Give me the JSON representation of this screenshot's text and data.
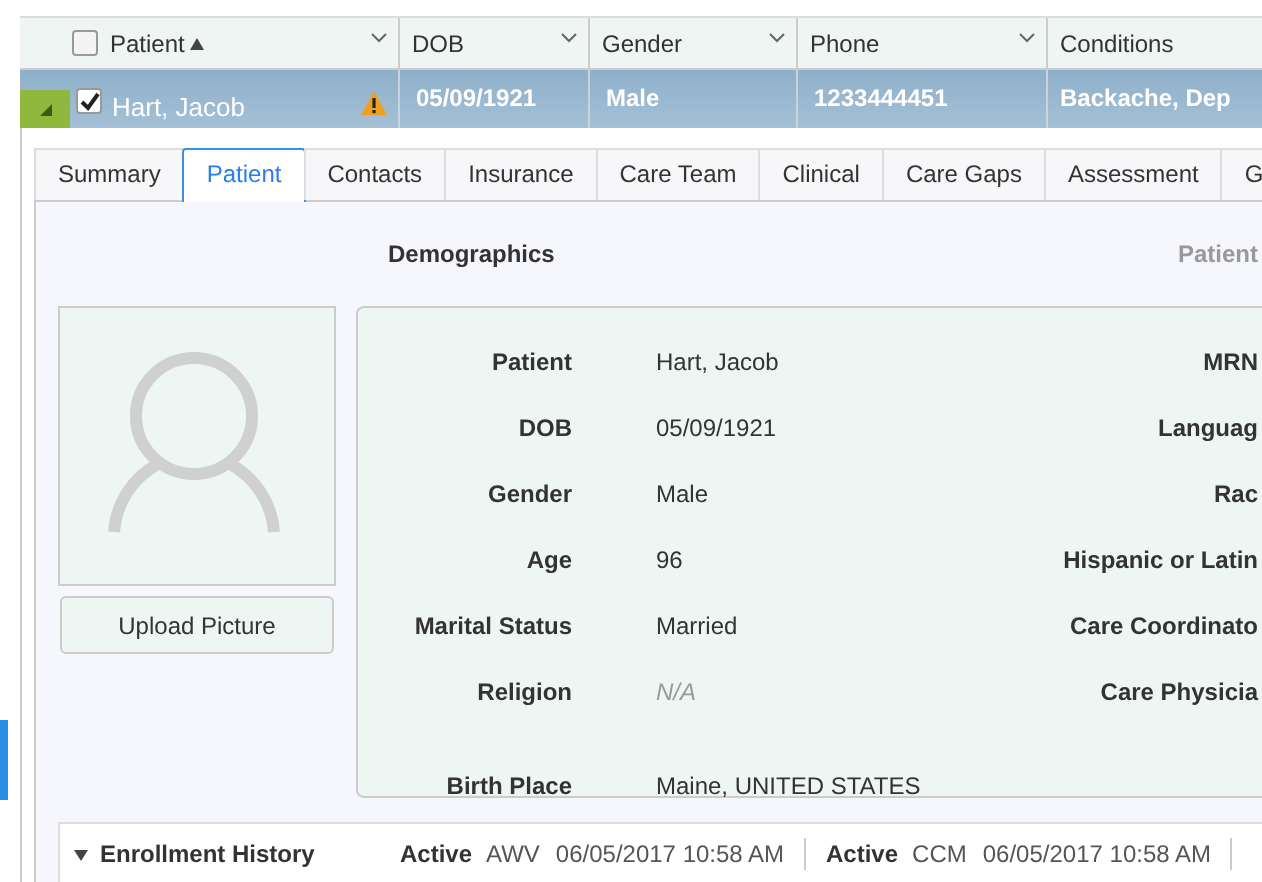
{
  "grid": {
    "header_checked": false,
    "columns": [
      {
        "label": "Patient",
        "sorted": true
      },
      {
        "label": "DOB",
        "sorted": false
      },
      {
        "label": "Gender",
        "sorted": false
      },
      {
        "label": "Phone",
        "sorted": false
      },
      {
        "label": "Conditions",
        "sorted": false
      }
    ],
    "row": {
      "selected": true,
      "checked": true,
      "expanded": true,
      "warning": true,
      "cells": [
        "Hart, Jacob",
        "05/09/1921",
        "Male",
        "1233444451",
        "Backache, Dep"
      ]
    }
  },
  "tabs": [
    {
      "label": "Summary",
      "selected": false
    },
    {
      "label": "Patient",
      "selected": true
    },
    {
      "label": "Contacts",
      "selected": false
    },
    {
      "label": "Insurance",
      "selected": false
    },
    {
      "label": "Care Team",
      "selected": false
    },
    {
      "label": "Clinical",
      "selected": false
    },
    {
      "label": "Care Gaps",
      "selected": false
    },
    {
      "label": "Assessment",
      "selected": false
    },
    {
      "label": "G",
      "selected": false
    }
  ],
  "demographics_heading": "Demographics",
  "right_heading": "Patient",
  "upload_button": "Upload Picture",
  "fields": [
    {
      "label": "Patient",
      "value": "Hart, Jacob",
      "empty": false
    },
    {
      "label": "DOB",
      "value": "05/09/1921",
      "empty": false
    },
    {
      "label": "Gender",
      "value": "Male",
      "empty": false
    },
    {
      "label": "Age",
      "value": "96",
      "empty": false
    },
    {
      "label": "Marital Status",
      "value": "Married",
      "empty": false
    },
    {
      "label": "Religion",
      "value": "N/A",
      "empty": true
    },
    {
      "label": "Birth Place",
      "value": "Maine, UNITED STATES",
      "empty": false
    }
  ],
  "right_fields": [
    "MRN",
    "Languag",
    "Rac",
    "Hispanic or Latin",
    "Care Coordinato",
    "Care Physicia"
  ],
  "enrollment": {
    "title": "Enrollment History",
    "expanded": true,
    "entries": [
      {
        "status": "Active",
        "program": "AWV",
        "date": "06/05/2017 10:58 AM"
      },
      {
        "status": "Active",
        "program": "CCM",
        "date": "06/05/2017 10:58 AM"
      }
    ]
  }
}
